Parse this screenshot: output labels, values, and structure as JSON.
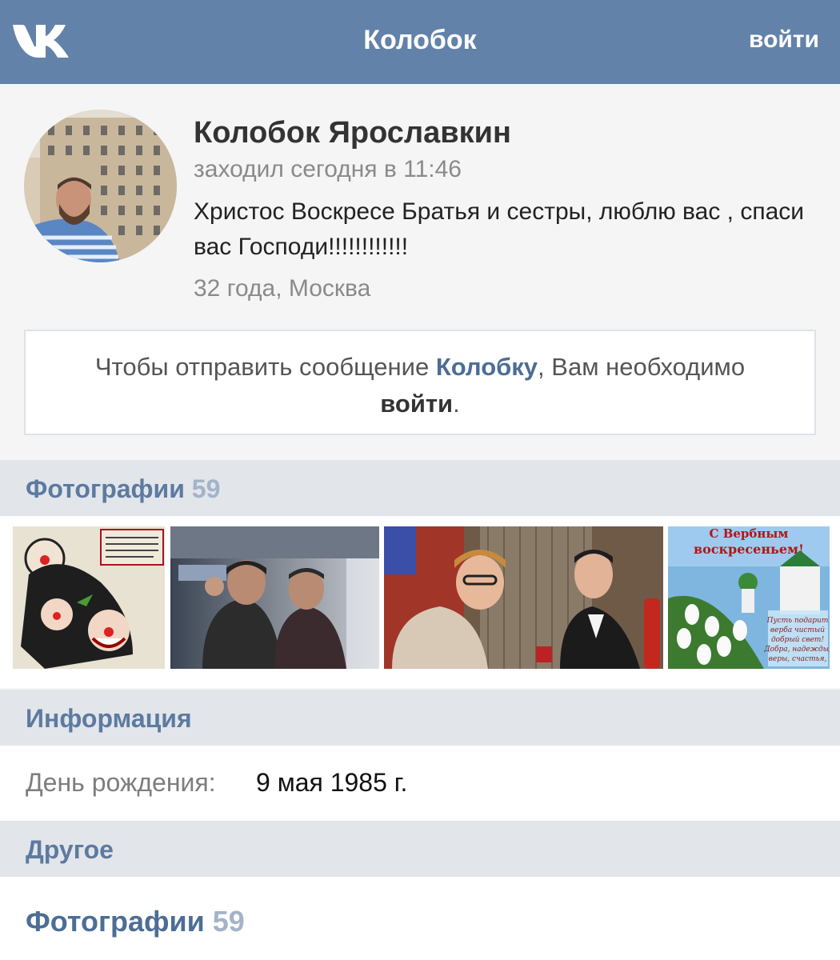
{
  "header": {
    "title": "Колобок",
    "login_label": "войти"
  },
  "profile": {
    "name": "Колобок Ярославкин",
    "last_seen": "заходил сегодня в 11:46",
    "status": "Христос Воскресе Братья и сестры, люблю вас , спаси вас Господи!!!!!!!!!!!!",
    "age_city": "32 года, Москва"
  },
  "message_box": {
    "text_before": "Чтобы отправить сообщение ",
    "name_link": "Колобку",
    "text_middle": ", Вам необходимо ",
    "login_link": "войти",
    "text_after": "."
  },
  "photos_section": {
    "title": "Фотографии",
    "count": "59"
  },
  "photos": [
    {
      "name": "photo-cartoon-poster",
      "caption_lines": []
    },
    {
      "name": "photo-two-men",
      "caption_lines": []
    },
    {
      "name": "photo-movie-scene",
      "caption_lines": []
    },
    {
      "name": "photo-easter-greeting",
      "caption_lines": [
        "Пусть подарит",
        "верба чистый",
        "добрый свет!",
        "Добра, надежды,",
        "веры, счастья,"
      ]
    }
  ],
  "info_section": {
    "title": "Информация"
  },
  "info": {
    "birthday_label": "День рождения:",
    "birthday_value": "9 мая 1985 г."
  },
  "other_section": {
    "title": "Другое"
  },
  "other_photos": {
    "title": "Фотографии",
    "count": "59"
  },
  "colors": {
    "header_bg": "#6282a9",
    "accent": "#4d6d94",
    "section_bg": "#e2e5ea",
    "count_gray": "#a3b3c8"
  }
}
